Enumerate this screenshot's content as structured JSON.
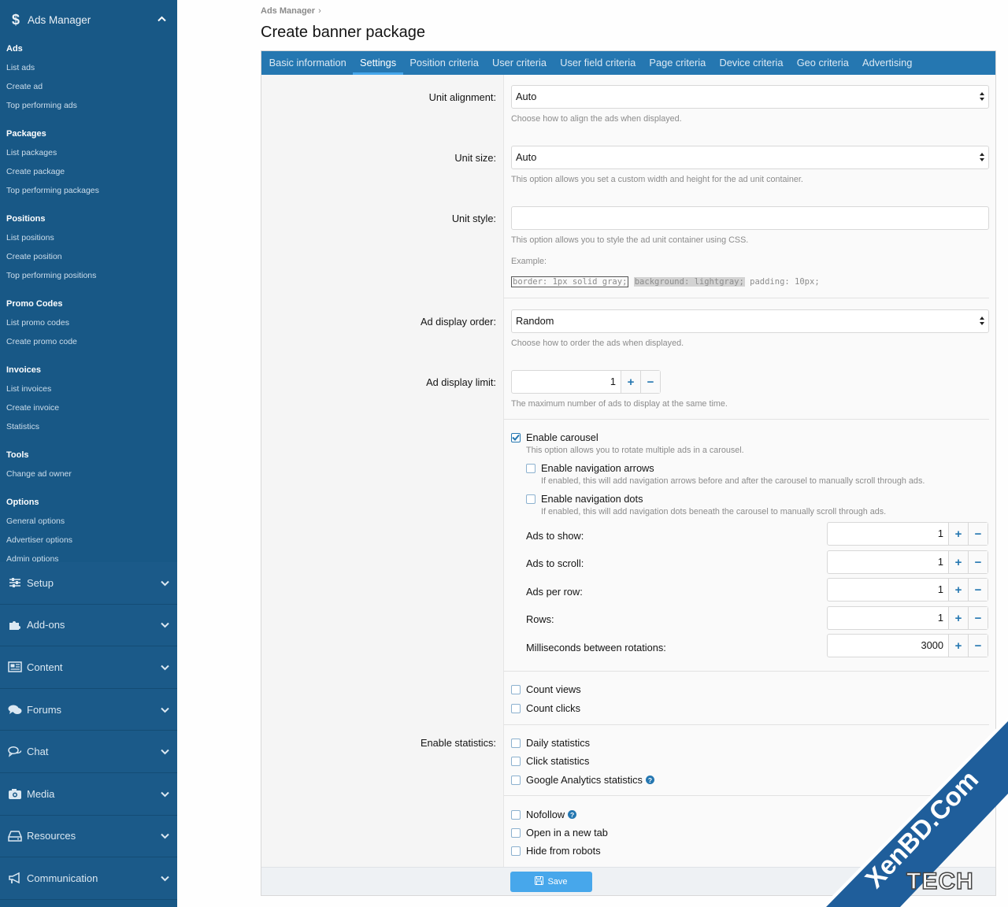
{
  "sidebar": {
    "header": "Ads Manager",
    "sections": [
      {
        "title": "Ads",
        "links": [
          "List ads",
          "Create ad",
          "Top performing ads"
        ]
      },
      {
        "title": "Packages",
        "links": [
          "List packages",
          "Create package",
          "Top performing packages"
        ]
      },
      {
        "title": "Positions",
        "links": [
          "List positions",
          "Create position",
          "Top performing positions"
        ]
      },
      {
        "title": "Promo Codes",
        "links": [
          "List promo codes",
          "Create promo code"
        ]
      },
      {
        "title": "Invoices",
        "links": [
          "List invoices",
          "Create invoice",
          "Statistics"
        ]
      },
      {
        "title": "Tools",
        "links": [
          "Change ad owner"
        ]
      },
      {
        "title": "Options",
        "links": [
          "General options",
          "Advertiser options",
          "Admin options"
        ]
      }
    ],
    "groups": [
      {
        "label": "Setup",
        "icon": "sliders-icon"
      },
      {
        "label": "Add-ons",
        "icon": "puzzle-icon"
      },
      {
        "label": "Content",
        "icon": "newspaper-icon"
      },
      {
        "label": "Forums",
        "icon": "comments-icon"
      },
      {
        "label": "Chat",
        "icon": "chat-icon"
      },
      {
        "label": "Media",
        "icon": "camera-icon"
      },
      {
        "label": "Resources",
        "icon": "drive-icon"
      },
      {
        "label": "Communication",
        "icon": "bullhorn-icon"
      }
    ]
  },
  "breadcrumb": {
    "item": "Ads Manager",
    "sep": "›"
  },
  "page_title": "Create banner package",
  "tabs": [
    "Basic information",
    "Settings",
    "Position criteria",
    "User criteria",
    "User field criteria",
    "Page criteria",
    "Device criteria",
    "Geo criteria",
    "Advertising"
  ],
  "active_tab": "Settings",
  "form": {
    "unit_alignment": {
      "label": "Unit alignment:",
      "value": "Auto",
      "hint": "Choose how to align the ads when displayed."
    },
    "unit_size": {
      "label": "Unit size:",
      "value": "Auto",
      "hint": "This option allows you set a custom width and height for the ad unit container."
    },
    "unit_style": {
      "label": "Unit style:",
      "value": "",
      "hint": "This option allows you to style the ad unit container using CSS.",
      "example_label": "Example:",
      "example_1": "border: 1px solid gray;",
      "example_2": "background: lightgray;",
      "example_3": "padding: 10px;"
    },
    "display_order": {
      "label": "Ad display order:",
      "value": "Random",
      "hint": "Choose how to order the ads when displayed."
    },
    "display_limit": {
      "label": "Ad display limit:",
      "value": "1",
      "hint": "The maximum number of ads to display at the same time."
    },
    "carousel": {
      "enable_label": "Enable carousel",
      "enabled": true,
      "enable_hint": "This option allows you to rotate multiple ads in a carousel.",
      "nav_arrows_label": "Enable navigation arrows",
      "nav_arrows_hint": "If enabled, this will add navigation arrows before and after the carousel to manually scroll through ads.",
      "nav_dots_label": "Enable navigation dots",
      "nav_dots_hint": "If enabled, this will add navigation dots beneath the carousel to manually scroll through ads.",
      "ads_to_show": {
        "label": "Ads to show:",
        "value": "1"
      },
      "ads_to_scroll": {
        "label": "Ads to scroll:",
        "value": "1"
      },
      "ads_per_row": {
        "label": "Ads per row:",
        "value": "1"
      },
      "rows": {
        "label": "Rows:",
        "value": "1"
      },
      "ms_between": {
        "label": "Milliseconds between rotations:",
        "value": "3000"
      }
    },
    "count_views": "Count views",
    "count_clicks": "Count clicks",
    "statistics_label": "Enable statistics:",
    "daily_statistics": "Daily statistics",
    "click_statistics": "Click statistics",
    "ga_statistics": "Google Analytics statistics",
    "nofollow": "Nofollow",
    "new_tab": "Open in a new tab",
    "hide_robots": "Hide from robots",
    "save": "Save"
  },
  "watermark": {
    "line1": "XenBD.Com",
    "line2": "TECH"
  },
  "colors": {
    "sidebar": "#185886",
    "tabs": "#2577b1",
    "button": "#47a7eb",
    "accent": "#2577b1"
  }
}
